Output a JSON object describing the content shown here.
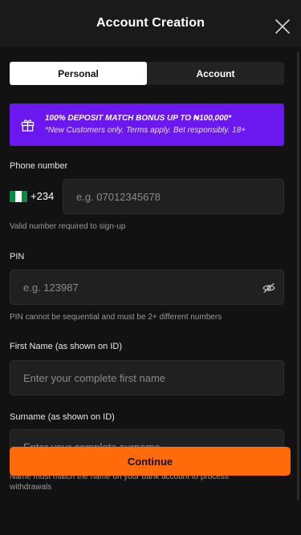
{
  "header": {
    "title": "Account Creation"
  },
  "tabs": [
    {
      "label": "Personal",
      "active": true
    },
    {
      "label": "Account",
      "active": false
    }
  ],
  "promo": {
    "headline": "100% DEPOSIT MATCH BONUS UP TO ₦100,000*",
    "terms": "*New Customers only. Terms apply. Bet responsibly. 18+",
    "icon": "gift-icon"
  },
  "phone": {
    "label": "Phone number",
    "country_code": "+234",
    "placeholder": "e.g. 07012345678",
    "hint": "Valid number required to sign-up"
  },
  "pin": {
    "label": "PIN",
    "placeholder": "e.g. 123987",
    "hint": "PIN cannot be sequential and must be 2+ different numbers"
  },
  "first_name": {
    "label": "First Name (as shown on ID)",
    "placeholder": "Enter your complete first name"
  },
  "surname": {
    "label": "Surname (as shown on ID)",
    "placeholder": "Enter your complete surname",
    "hint": "Name must match the name on your bank account to process withdrawals"
  },
  "continue_label": "Continue",
  "colors": {
    "accent": "#ff6a0a",
    "promo": "#6a17f0",
    "background": "#121212"
  }
}
